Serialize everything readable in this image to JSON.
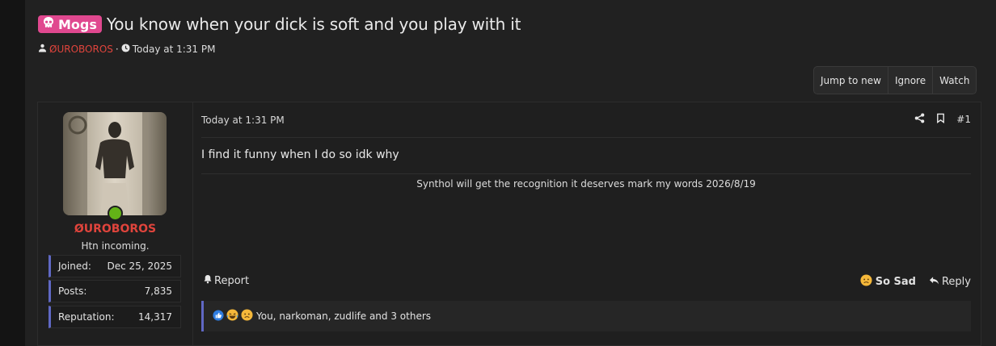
{
  "thread": {
    "prefix": "Mogs",
    "title": "You know when your dick is soft and you play with it",
    "author": "ØUROBOROS",
    "separator": "·",
    "time": "Today at 1:31 PM"
  },
  "actions": {
    "jump_to_new": "Jump to new",
    "ignore": "Ignore",
    "watch": "Watch"
  },
  "post": {
    "user": {
      "name": "ØUROBOROS",
      "title": "Htn incoming.",
      "stats": [
        {
          "label": "Joined:",
          "value": "Dec 25, 2025"
        },
        {
          "label": "Posts:",
          "value": "7,835"
        },
        {
          "label": "Reputation:",
          "value": "14,317"
        }
      ]
    },
    "date": "Today at 1:31 PM",
    "number": "#1",
    "message": "I find it funny when I do so idk why",
    "signature": "Synthol will get the recognition it deserves mark my words 2026/8/19",
    "report": "Report",
    "so_sad": "So Sad",
    "reply": "Reply",
    "reactions_text": "You, narkoman, zudlife and 3 others"
  },
  "colors": {
    "username": "#e0443c",
    "prefix_badge": "#e0488f",
    "accent_border": "#6068c4",
    "online": "#63b317"
  }
}
